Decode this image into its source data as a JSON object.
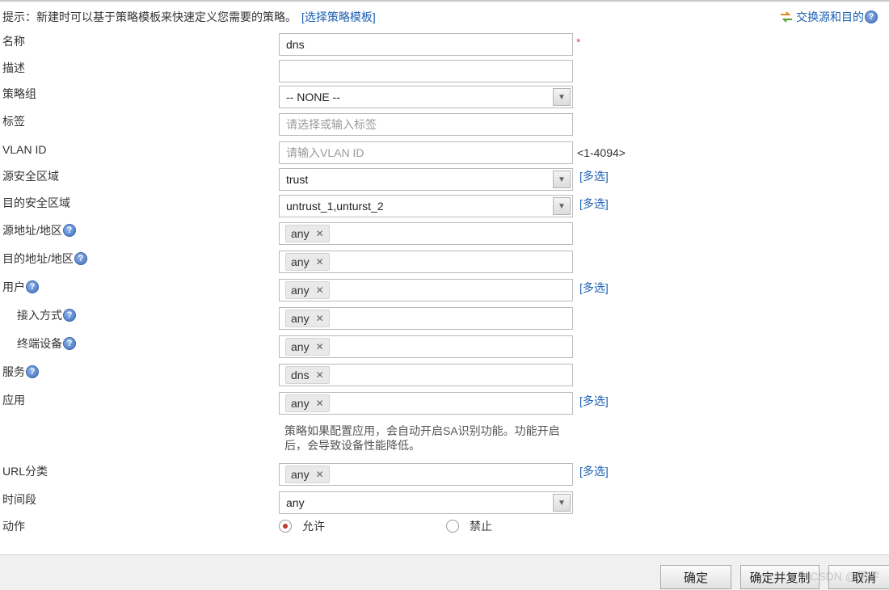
{
  "tip": {
    "text": "提示：新建时可以基于策略模板来快速定义您需要的策略。",
    "template_link": "[选择策略模板]"
  },
  "swap": {
    "label": "交换源和目的",
    "icon": "swap-arrows-icon"
  },
  "help_glyph": "?",
  "form": {
    "name": {
      "label": "名称",
      "value": "dns",
      "required_mark": "*"
    },
    "description": {
      "label": "描述",
      "value": ""
    },
    "policy_group": {
      "label": "策略组",
      "value": "-- NONE --"
    },
    "tag": {
      "label": "标签",
      "placeholder": "请选择或输入标签"
    },
    "vlan_id": {
      "label": "VLAN ID",
      "placeholder": "请输入VLAN ID",
      "range_hint": "<1-4094>"
    },
    "src_zone": {
      "label": "源安全区域",
      "value": "trust",
      "multi": "[多选]"
    },
    "dst_zone": {
      "label": "目的安全区域",
      "value": "untrust_1,unturst_2",
      "multi": "[多选]"
    },
    "src_addr": {
      "label": "源地址/地区",
      "tag": "any"
    },
    "dst_addr": {
      "label": "目的地址/地区",
      "tag": "any"
    },
    "user": {
      "label": "用户",
      "tag": "any",
      "multi": "[多选]"
    },
    "access_mode": {
      "label": "接入方式",
      "tag": "any"
    },
    "terminal": {
      "label": "终端设备",
      "tag": "any"
    },
    "service": {
      "label": "服务",
      "tag": "dns"
    },
    "application": {
      "label": "应用",
      "tag": "any",
      "multi": "[多选]",
      "note_line1": "策略如果配置应用，会自动开启SA识别功能。功能开启",
      "note_line2": "后，会导致设备性能降低。"
    },
    "url_category": {
      "label": "URL分类",
      "tag": "any",
      "multi": "[多选]"
    },
    "time_range": {
      "label": "时间段",
      "value": "any"
    },
    "action": {
      "label": "动作",
      "options": [
        "允许",
        "禁止"
      ],
      "selected": "允许"
    }
  },
  "footer": {
    "ok": "确定",
    "ok_copy": "确定并复制",
    "cancel": "取消",
    "watermark": "CSDN @鹏宇"
  },
  "colors": {
    "link": "#1a5fb4",
    "required": "#d9534f",
    "radio_selected": "#c0392b"
  }
}
